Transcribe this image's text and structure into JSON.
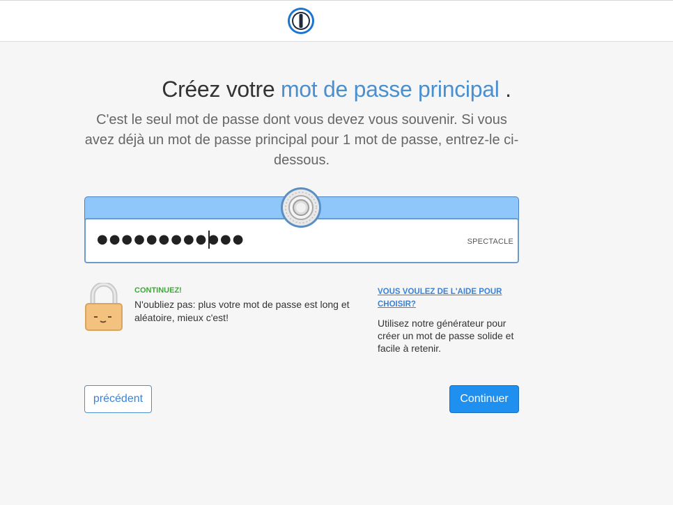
{
  "header": {
    "logo_icon": "keyhole-logo-icon"
  },
  "main": {
    "title_part1": "Créez votre",
    "title_accent": "mot de passe principal",
    "title_part2": ".",
    "subtitle": "C'est le seul mot de passe dont vous devez vous souvenir. Si vous avez déjà un mot de passe principal pour 1 mot de passe, entrez-le ci-dessous.",
    "password": {
      "value_masked": "●●●●●●●●●●●●",
      "reveal_label": "SPECTACLE"
    },
    "tip": {
      "heading": "CONTINUEZ!",
      "text": "N'oubliez pas: plus votre mot de passe est long et aléatoire, mieux c'est!"
    },
    "help": {
      "link": "VOUS VOULEZ DE L'AIDE POUR CHOISIR?",
      "text": "Utilisez notre générateur pour créer un mot de passe solide et facile à retenir."
    },
    "buttons": {
      "previous": "précédent",
      "continue": "Continuer"
    }
  },
  "colors": {
    "accent": "#4a8fd0",
    "primary_button": "#1f8ff0",
    "band": "#8fc7fb",
    "tip_heading": "#3aaa35"
  }
}
